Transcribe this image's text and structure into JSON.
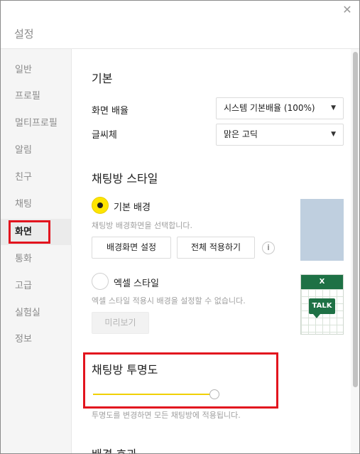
{
  "window": {
    "title": "설정",
    "close_icon": "close-icon"
  },
  "sidebar": {
    "items": [
      {
        "label": "일반"
      },
      {
        "label": "프로필"
      },
      {
        "label": "멀티프로필"
      },
      {
        "label": "알림"
      },
      {
        "label": "친구"
      },
      {
        "label": "채팅"
      },
      {
        "label": "화면",
        "active": true
      },
      {
        "label": "통화"
      },
      {
        "label": "고급"
      },
      {
        "label": "실험실"
      },
      {
        "label": "정보"
      }
    ]
  },
  "basic": {
    "title": "기본",
    "zoom_label": "화면 배율",
    "zoom_value": "시스템 기본배율 (100%)",
    "font_label": "글씨체",
    "font_value": "맑은 고딕"
  },
  "chat_style": {
    "title": "채팅방 스타일",
    "default_bg": {
      "label": "기본 배경",
      "selected": true,
      "desc": "채팅방 배경화면을 선택합니다.",
      "set_button": "배경화면 설정",
      "apply_all_button": "전체 적용하기",
      "info_icon": "info-icon"
    },
    "excel": {
      "label": "엑셀 스타일",
      "selected": false,
      "desc": "엑셀 스타일 적용시 배경을 설정할 수 없습니다.",
      "preview_button": "미리보기",
      "preview_header": "X",
      "preview_badge": "TALK"
    },
    "preview_colors": {
      "default_bg": "#bfcfdf",
      "excel_green": "#1e7145"
    }
  },
  "transparency": {
    "title": "채팅방 투명도",
    "value_fraction": 1.0,
    "desc": "투명도를 변경하면 모든 채팅방에 적용됩니다."
  },
  "next_section": {
    "title": "배경 효과"
  },
  "colors": {
    "accent_yellow": "#fee500",
    "highlight_red": "#e2141e",
    "muted_text": "#8a8a8a"
  }
}
